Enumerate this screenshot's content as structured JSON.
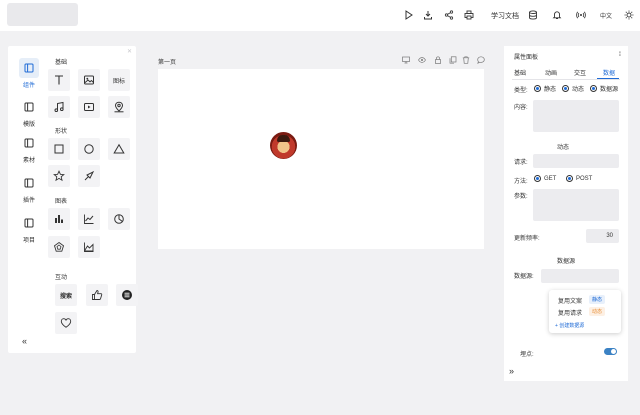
{
  "topbar": {
    "docs_label": "学习文档",
    "lang_label": "中文",
    "icons": [
      "play-icon",
      "download-icon",
      "share-icon",
      "print-icon",
      "database-icon",
      "bell-icon",
      "broadcast-icon",
      "sun-icon"
    ]
  },
  "sidenav": [
    {
      "label": "组件",
      "active": true
    },
    {
      "label": "模版",
      "active": false
    },
    {
      "label": "素材",
      "active": false
    },
    {
      "label": "插件",
      "active": false
    },
    {
      "label": "项目",
      "active": false
    }
  ],
  "components": {
    "basic_title": "基础",
    "shape_title": "形状",
    "chart_title": "图表",
    "interact_title": "互动",
    "icon_tile_label": "图标",
    "search_tile_label": "搜索"
  },
  "canvas": {
    "page_label": "第一页"
  },
  "props": {
    "title": "属性面板",
    "tabs": [
      "基础",
      "动画",
      "交互",
      "数据"
    ],
    "active_tab": "数据",
    "type_label": "类型:",
    "type_options": [
      "静态",
      "动态",
      "数据源"
    ],
    "content_label": "内容:",
    "dynamic_section": "动态",
    "request_label": "请求:",
    "method_label": "方法:",
    "method_options": [
      "GET",
      "POST"
    ],
    "params_label": "参数:",
    "refresh_label": "更新频率:",
    "refresh_value": "30",
    "datasource_section": "数据源",
    "datasource_label": "数据源:",
    "popup_items": [
      {
        "name": "复用文案",
        "tag": "静态"
      },
      {
        "name": "复用请求",
        "tag": "动态"
      }
    ],
    "create_link": "+ 创建数据源",
    "tracking_label": "埋点:",
    "tracking_on": true
  },
  "colors": {
    "accent": "#1f6bd6",
    "toggle": "#3b82c4"
  }
}
